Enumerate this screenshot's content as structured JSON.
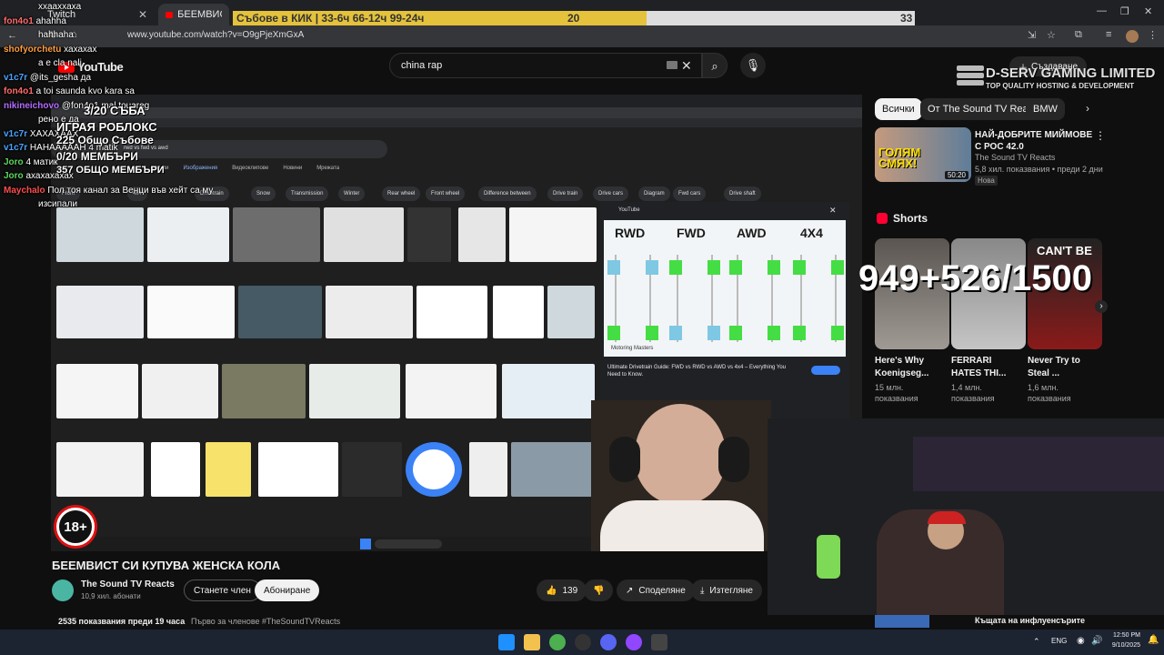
{
  "browser": {
    "tabs": [
      {
        "label": "Twitch"
      },
      {
        "label": "БЕЕМВИСТ СИ КУПУВА ЖЕ..."
      }
    ],
    "url": "www.youtube.com/watch?v=O9gPjeXmGxA"
  },
  "youtube": {
    "logo": "YouTube",
    "search_value": "china rap",
    "create_label": "Създаване"
  },
  "stream_overlay": {
    "topbar_text": "Събове в КИК | 33-6ч 66-12ч 99-24ч",
    "topbar_left_num": "20",
    "topbar_right_num": "33",
    "subs_goal": "3/20 СЪБА",
    "game_label": "ИГРАЯ РОБЛОКС",
    "subs_total": "225 Общо Събове",
    "members": "0/20 МЕМБЪРИ",
    "members_total": "357 ОБЩО МЕМБЪРИ",
    "matik": "4 матик",
    "counter": "949+526/1500",
    "sponsor_name": "D-SERV GAMING LIMITED",
    "sponsor_tag": "TOP QUALITY HOSTING & DEVELOPMENT",
    "age_badge": "18+",
    "chat": [
      {
        "user": "",
        "text": "xxaaxxaxa",
        "color": "#ffffff"
      },
      {
        "user": "fon4o1",
        "text": "ahahha",
        "color": "#ff6b6b"
      },
      {
        "user": "",
        "text": "hahhaha",
        "color": "#ffffff"
      },
      {
        "user": "shofyorchetu",
        "text": "хахахах",
        "color": "#ff9f43"
      },
      {
        "user": "",
        "text": "а е сla nali",
        "color": "#ffffff"
      },
      {
        "user": "v1c7r",
        "text": "@its_gesha да",
        "color": "#4aa3ff"
      },
      {
        "user": "fon4o1",
        "text": "a toi saunda kvo kara sa",
        "color": "#ff6b6b"
      },
      {
        "user": "nikineichovo",
        "text": "@fon4o1 mal touareg",
        "color": "#b46bff"
      },
      {
        "user": "",
        "text": "рено е да",
        "color": "#ffffff"
      },
      {
        "user": "v1c7r",
        "text": "ХАХАХААХ",
        "color": "#4aa3ff"
      },
      {
        "user": "v1c7r",
        "text": "НАНАААААН 4 matik",
        "color": "#4aa3ff"
      },
      {
        "user": "Joro",
        "text": "4 матик",
        "color": "#5cd65c"
      },
      {
        "user": "Joro",
        "text": "ахахахахах",
        "color": "#5cd65c"
      },
      {
        "user": "Maychalo",
        "text": "Пол тоя канал за Венци във хейт са му",
        "color": "#ff4d4d"
      },
      {
        "user": "",
        "text": "изсипали",
        "color": "#ffffff"
      }
    ]
  },
  "video": {
    "title": "БЕЕМВИСТ СИ КУПУВА ЖЕНСКА КОЛА",
    "channel": "The Sound TV Reacts",
    "subscribers": "10,9 хил. абонати",
    "join_label": "Станете член",
    "subscribe_label": "Абониране",
    "likes": "139",
    "share_label": "Споделяне",
    "download_label": "Изтегляне",
    "meta": "2535 показвания  преди 19 часа",
    "meta_extra": "Първо за членове #TheSoundTVReacts",
    "inner": {
      "google_query": "rwd vs fwd vs awd",
      "tabs": [
        "Всички",
        "Изображения",
        "Видеоклипове",
        "Новини",
        "Мрежата"
      ],
      "chips": [
        "Front",
        "4x4",
        "Drivetrain",
        "Snow",
        "Transmission",
        "Winter",
        "Rear wheel",
        "Front wheel",
        "Difference between",
        "Drive train",
        "Drive cars",
        "Diagram",
        "Fwd cars",
        "Drive shaft"
      ],
      "preview_title": "Ultimate Drivetrain Guide: FWD vs RWD vs AWD vs 4x4 – Everything You Need to Know.",
      "preview_source": "YouTube",
      "preview_labels": [
        "RWD",
        "FWD",
        "AWD",
        "4X4"
      ],
      "preview_brand": "Motoring Masters"
    }
  },
  "sidebar": {
    "chips": [
      "Всички",
      "От The Sound TV Reacts",
      "BMW"
    ],
    "featured": {
      "title": "НАЙ-ДОБРИТЕ МИЙМОВЕ С РОС 42.0",
      "channel": "The Sound TV Reacts",
      "stats": "5,8 хил. показвания • преди 2 дни",
      "badge": "Нова",
      "duration": "50:20",
      "thumb_text": "ГОЛЯМ СМЯХ!"
    },
    "shorts_heading": "Shorts",
    "shorts": [
      {
        "title": "Here's Why Koenigseg...",
        "views": "15 млн. показвания"
      },
      {
        "title": "FERRARI HATES THI...",
        "views": "1,4 млн. показвания"
      },
      {
        "title": "Never Try to Steal ...",
        "views": "1,6 млн. показвания"
      }
    ],
    "short_overlay": "CAN'T BE",
    "bottom_video": "Къщата на инфлуенсърите"
  },
  "taskbar": {
    "lang": "ENG",
    "time": "12:50 PM",
    "date": "9/10/2025"
  }
}
